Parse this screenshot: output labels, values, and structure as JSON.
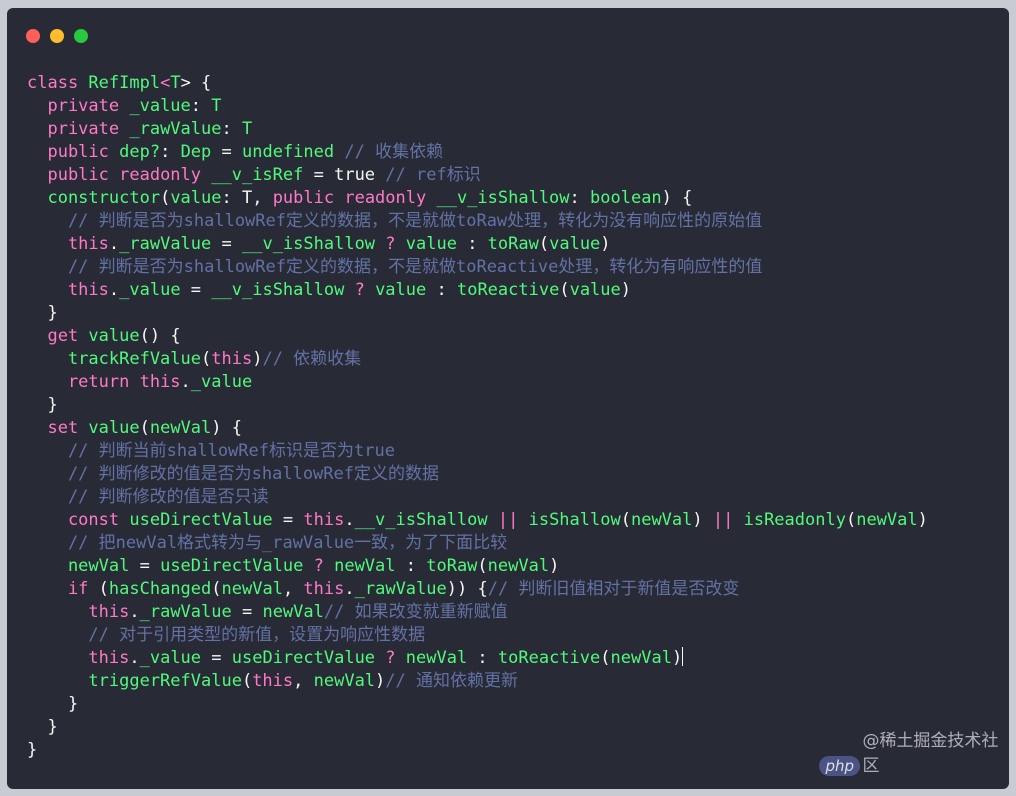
{
  "colors": {
    "background": "#282a36",
    "keyword": "#ff79c6",
    "type": "#8be9fd",
    "identifier": "#50fa7b",
    "plain": "#f8f8f2",
    "comment": "#6272a4"
  },
  "window_controls": [
    "close-dot",
    "minimize-dot",
    "maximize-dot"
  ],
  "code_lines": [
    [
      [
        "class ",
        "k"
      ],
      [
        "RefImpl",
        "f"
      ],
      [
        "<",
        "o"
      ],
      [
        "T",
        "f"
      ],
      [
        "> {",
        "p"
      ]
    ],
    [
      [
        "  private ",
        "k"
      ],
      [
        "_value",
        "f"
      ],
      [
        ": ",
        "p"
      ],
      [
        "T",
        "f"
      ]
    ],
    [
      [
        "  private ",
        "k"
      ],
      [
        "_rawValue",
        "f"
      ],
      [
        ": ",
        "p"
      ],
      [
        "T",
        "f"
      ]
    ],
    [
      [
        "  public ",
        "k"
      ],
      [
        "dep?",
        "f"
      ],
      [
        ": ",
        "p"
      ],
      [
        "Dep",
        "f"
      ],
      [
        " = ",
        "p"
      ],
      [
        "undefined",
        "f"
      ],
      [
        " // 收集依赖",
        "m"
      ]
    ],
    [
      [
        "  public ",
        "k"
      ],
      [
        "readonly ",
        "k"
      ],
      [
        "__v_isRef",
        "f"
      ],
      [
        " = ",
        "p"
      ],
      [
        "true",
        "p"
      ],
      [
        " // ref标识",
        "m"
      ]
    ],
    [
      [
        "  constructor",
        "f"
      ],
      [
        "(",
        "p"
      ],
      [
        "value",
        "f"
      ],
      [
        ": T, ",
        "p"
      ],
      [
        "public ",
        "k"
      ],
      [
        "readonly ",
        "k"
      ],
      [
        "__v_isShallow",
        "f"
      ],
      [
        ": ",
        "p"
      ],
      [
        "boolean",
        "f"
      ],
      [
        ") {",
        "p"
      ]
    ],
    [
      [
        "    // 判断是否为shallowRef定义的数据，不是就做toRaw处理，转化为没有响应性的原始值",
        "m"
      ]
    ],
    [
      [
        "    this",
        "k"
      ],
      [
        ".",
        "p"
      ],
      [
        "_rawValue",
        "f"
      ],
      [
        " = ",
        "p"
      ],
      [
        "__v_isShallow",
        "f"
      ],
      [
        " ? ",
        "o"
      ],
      [
        "value",
        "f"
      ],
      [
        " : ",
        "p"
      ],
      [
        "toRaw",
        "f"
      ],
      [
        "(",
        "p"
      ],
      [
        "value",
        "f"
      ],
      [
        ")",
        "p"
      ]
    ],
    [
      [
        "    // 判断是否为shallowRef定义的数据，不是就做toReactive处理，转化为有响应性的值",
        "m"
      ]
    ],
    [
      [
        "    this",
        "k"
      ],
      [
        ".",
        "p"
      ],
      [
        "_value",
        "f"
      ],
      [
        " = ",
        "p"
      ],
      [
        "__v_isShallow",
        "f"
      ],
      [
        " ? ",
        "o"
      ],
      [
        "value",
        "f"
      ],
      [
        " : ",
        "p"
      ],
      [
        "toReactive",
        "f"
      ],
      [
        "(",
        "p"
      ],
      [
        "value",
        "f"
      ],
      [
        ")",
        "p"
      ]
    ],
    [
      [
        "  }",
        "p"
      ]
    ],
    [
      [
        "  get ",
        "k"
      ],
      [
        "value",
        "f"
      ],
      [
        "() {",
        "p"
      ]
    ],
    [
      [
        "    trackRefValue",
        "f"
      ],
      [
        "(",
        "p"
      ],
      [
        "this",
        "k"
      ],
      [
        ")",
        "p"
      ],
      [
        "// 依赖收集",
        "m"
      ]
    ],
    [
      [
        "    return ",
        "k"
      ],
      [
        "this",
        "k"
      ],
      [
        ".",
        "p"
      ],
      [
        "_value",
        "f"
      ]
    ],
    [
      [
        "  }",
        "p"
      ]
    ],
    [
      [
        "  set ",
        "k"
      ],
      [
        "value",
        "f"
      ],
      [
        "(",
        "p"
      ],
      [
        "newVal",
        "f"
      ],
      [
        ") {",
        "p"
      ]
    ],
    [
      [
        "    // 判断当前shallowRef标识是否为true",
        "m"
      ]
    ],
    [
      [
        "    // 判断修改的值是否为shallowRef定义的数据",
        "m"
      ]
    ],
    [
      [
        "    // 判断修改的值是否只读",
        "m"
      ]
    ],
    [
      [
        "    const ",
        "k"
      ],
      [
        "useDirectValue",
        "f"
      ],
      [
        " = ",
        "p"
      ],
      [
        "this",
        "k"
      ],
      [
        ".",
        "p"
      ],
      [
        "__v_isShallow",
        "f"
      ],
      [
        " || ",
        "o"
      ],
      [
        "isShallow",
        "f"
      ],
      [
        "(",
        "p"
      ],
      [
        "newVal",
        "f"
      ],
      [
        ")",
        "p"
      ],
      [
        " || ",
        "o"
      ],
      [
        "isReadonly",
        "f"
      ],
      [
        "(",
        "p"
      ],
      [
        "newVal",
        "f"
      ],
      [
        ")",
        "p"
      ]
    ],
    [
      [
        "    // 把newVal格式转为与_rawValue一致，为了下面比较",
        "m"
      ]
    ],
    [
      [
        "    newVal",
        "f"
      ],
      [
        " = ",
        "p"
      ],
      [
        "useDirectValue",
        "f"
      ],
      [
        " ? ",
        "o"
      ],
      [
        "newVal",
        "f"
      ],
      [
        " : ",
        "p"
      ],
      [
        "toRaw",
        "f"
      ],
      [
        "(",
        "p"
      ],
      [
        "newVal",
        "f"
      ],
      [
        ")",
        "p"
      ]
    ],
    [
      [
        "    if ",
        "k"
      ],
      [
        "(",
        "p"
      ],
      [
        "hasChanged",
        "f"
      ],
      [
        "(",
        "p"
      ],
      [
        "newVal",
        "f"
      ],
      [
        ", ",
        "p"
      ],
      [
        "this",
        "k"
      ],
      [
        ".",
        "p"
      ],
      [
        "_rawValue",
        "f"
      ],
      [
        ")) {",
        "p"
      ],
      [
        "// 判断旧值相对于新值是否改变",
        "m"
      ]
    ],
    [
      [
        "      this",
        "k"
      ],
      [
        ".",
        "p"
      ],
      [
        "_rawValue",
        "f"
      ],
      [
        " = ",
        "p"
      ],
      [
        "newVal",
        "f"
      ],
      [
        "// 如果改变就重新赋值",
        "m"
      ]
    ],
    [
      [
        "      // 对于引用类型的新值，设置为响应性数据",
        "m"
      ]
    ],
    [
      [
        "      this",
        "k"
      ],
      [
        ".",
        "p"
      ],
      [
        "_value",
        "f"
      ],
      [
        " = ",
        "p"
      ],
      [
        "useDirectValue",
        "f"
      ],
      [
        " ? ",
        "o"
      ],
      [
        "newVal",
        "f"
      ],
      [
        " : ",
        "p"
      ],
      [
        "toReactive",
        "f"
      ],
      [
        "(",
        "p"
      ],
      [
        "newVal",
        "f"
      ],
      [
        ")",
        "p"
      ]
    ],
    [
      [
        "      triggerRefValue",
        "f"
      ],
      [
        "(",
        "p"
      ],
      [
        "this",
        "k"
      ],
      [
        ", ",
        "p"
      ],
      [
        "newVal",
        "f"
      ],
      [
        ")",
        "p"
      ],
      [
        "// 通知依赖更新",
        "m"
      ]
    ],
    [
      [
        "    }",
        "p"
      ]
    ],
    [
      [
        "  }",
        "p"
      ]
    ],
    [
      [
        "}",
        "p"
      ]
    ]
  ],
  "cursor_line": 25,
  "watermark": {
    "text": "@稀土掘金技术社区",
    "badge": "php"
  }
}
